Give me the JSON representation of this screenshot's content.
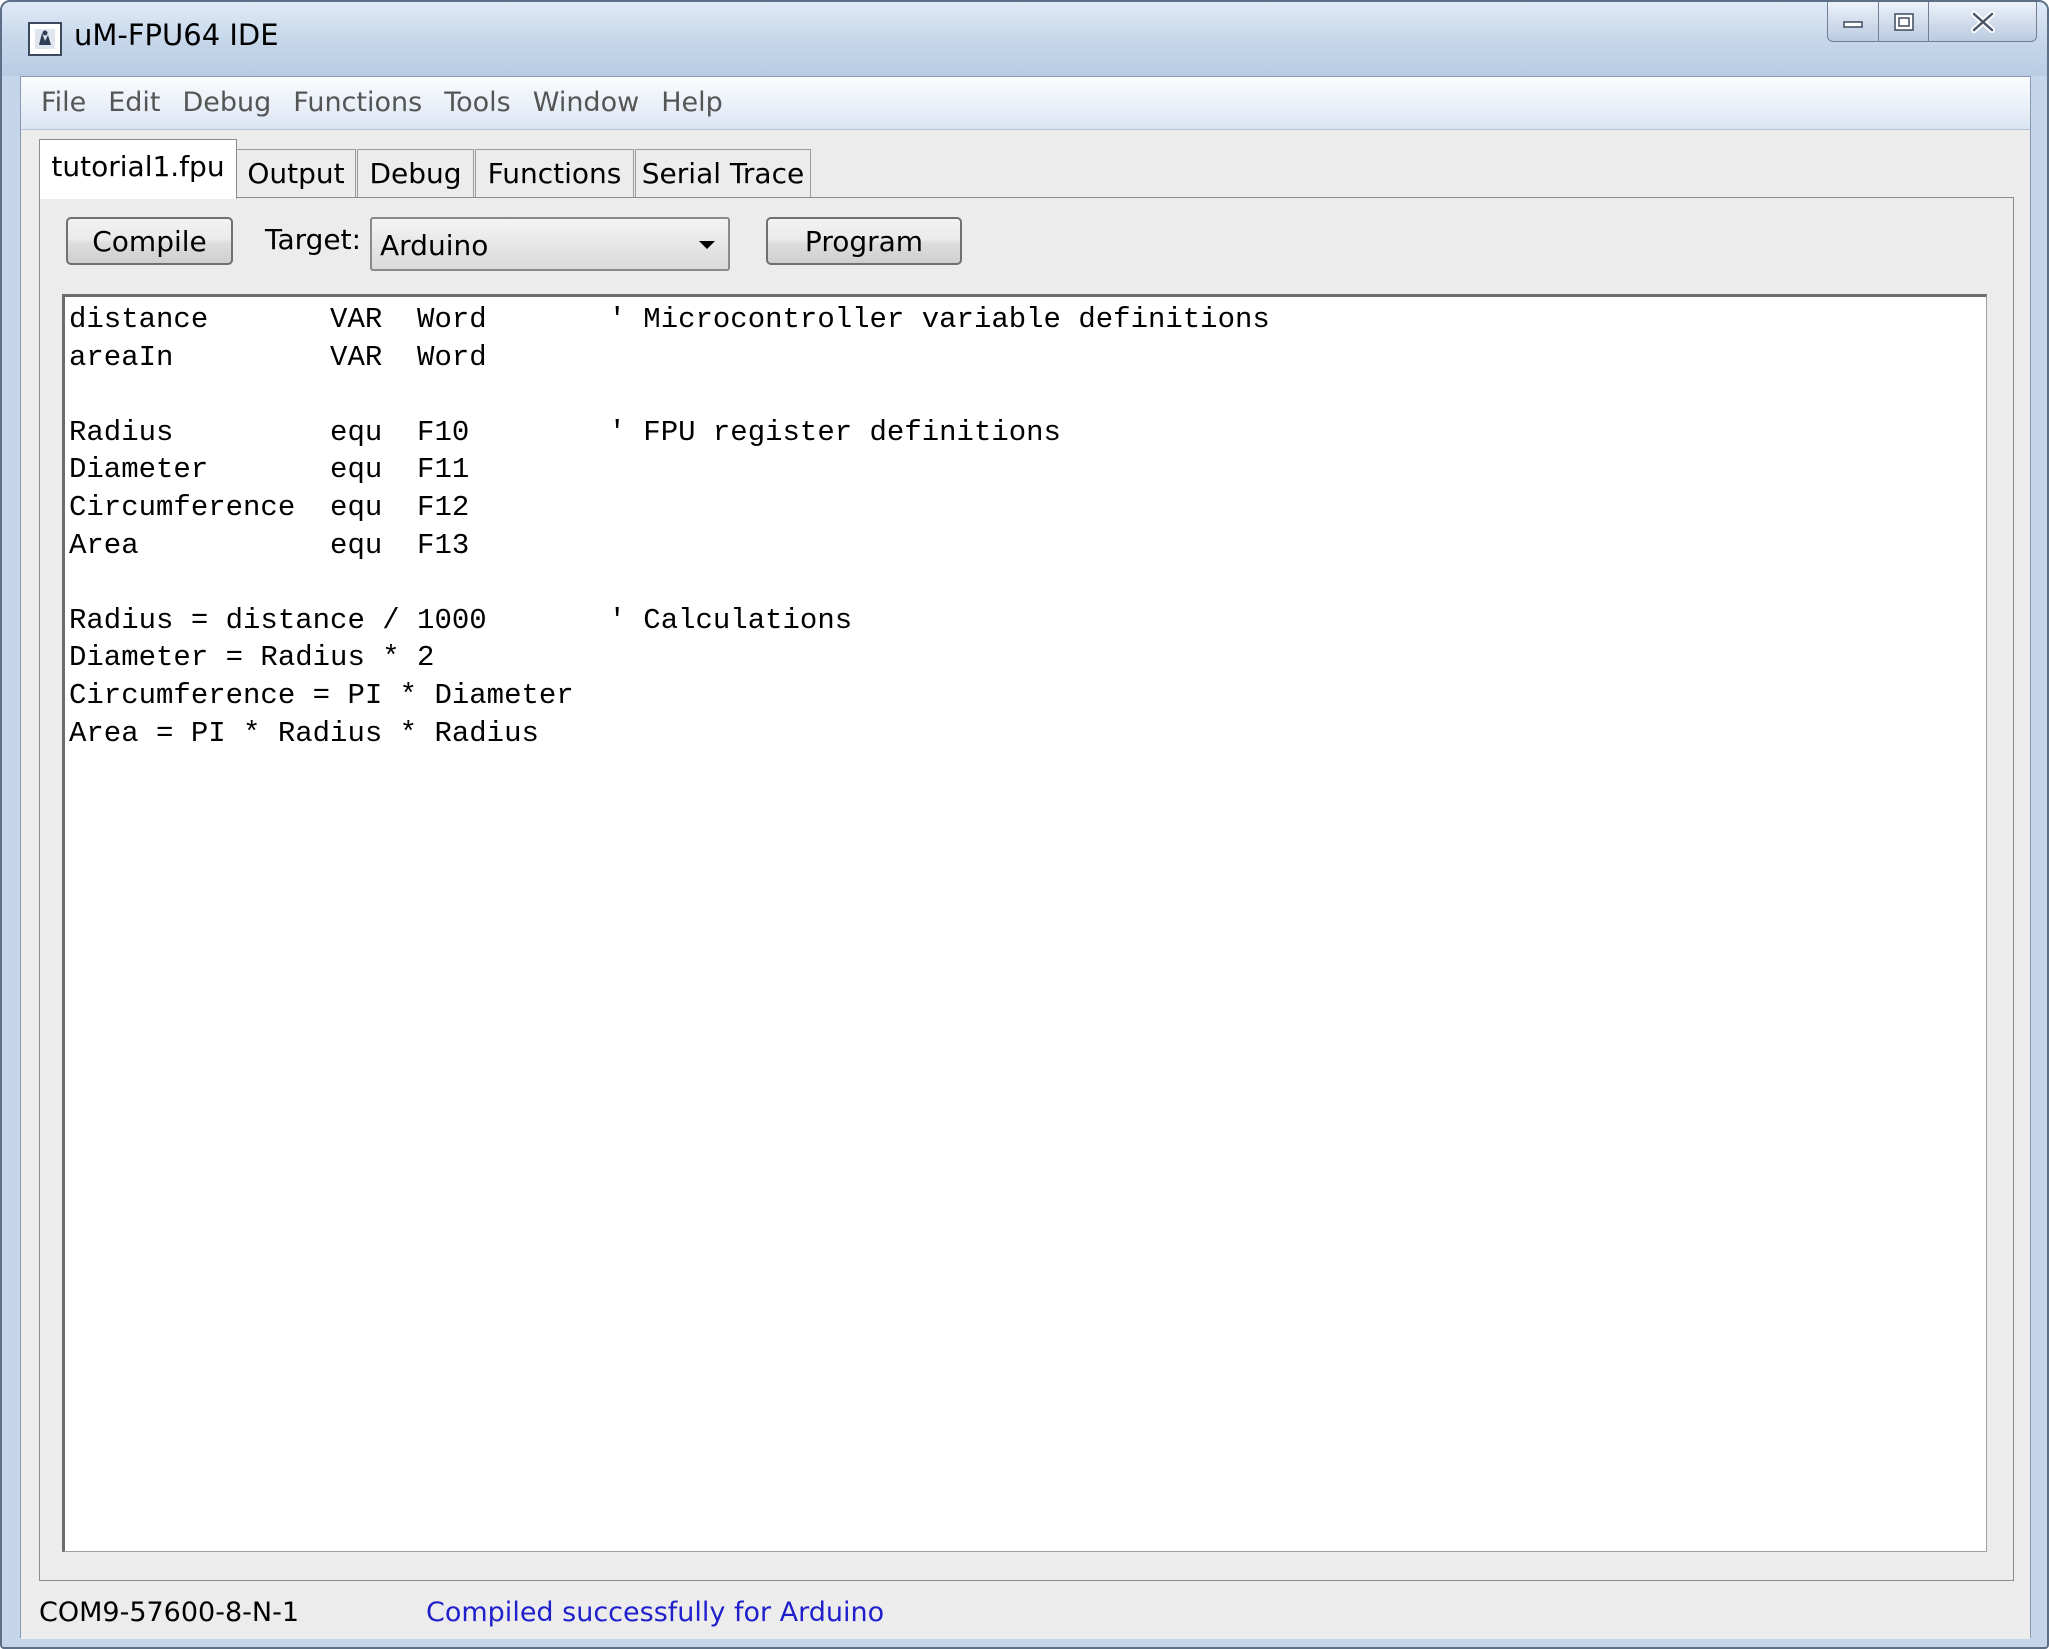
{
  "window": {
    "title": "uM-FPU64 IDE"
  },
  "menubar": {
    "items": [
      "File",
      "Edit",
      "Debug",
      "Functions",
      "Tools",
      "Window",
      "Help"
    ]
  },
  "tabs": [
    {
      "label": "tutorial1.fpu",
      "active": true
    },
    {
      "label": "Output",
      "active": false
    },
    {
      "label": "Debug",
      "active": false
    },
    {
      "label": "Functions",
      "active": false
    },
    {
      "label": "Serial Trace",
      "active": false
    }
  ],
  "toolbar": {
    "compile_label": "Compile",
    "target_label": "Target:",
    "target_value": "Arduino",
    "program_label": "Program"
  },
  "editor": {
    "lines": [
      "distance       VAR  Word       ' Microcontroller variable definitions",
      "areaIn         VAR  Word",
      "",
      "Radius         equ  F10        ' FPU register definitions",
      "Diameter       equ  F11",
      "Circumference  equ  F12",
      "Area           equ  F13",
      "",
      "Radius = distance / 1000       ' Calculations",
      "Diameter = Radius * 2",
      "Circumference = PI * Diameter",
      "Area = PI * Radius * Radius"
    ]
  },
  "status": {
    "port": "COM9-57600-8-N-1",
    "message": "Compiled successfully for Arduino",
    "message_color": "#1f1fcc"
  }
}
